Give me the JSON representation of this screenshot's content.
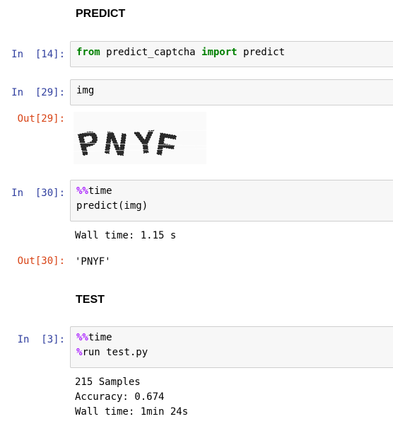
{
  "sections": {
    "predict_heading": "PREDICT",
    "test_heading": "TEST"
  },
  "cells": {
    "c14": {
      "prompt": "In  [14]:",
      "code": {
        "kw1": "from",
        "module": " predict_captcha ",
        "kw2": "import",
        "name": " predict"
      }
    },
    "c29": {
      "prompt": "In  [29]:",
      "code": "img",
      "out_prompt": "Out[29]:",
      "image_text": "PNYF"
    },
    "c30": {
      "prompt": "In  [30]:",
      "line1_magic": "%%",
      "line1_rest": "time",
      "line2": "predict(img)",
      "stdout": "Wall time: 1.15 s",
      "out_prompt": "Out[30]:",
      "result": "'PNYF'"
    },
    "c3": {
      "prompt": "In  [3]:",
      "line1_magic": "%%",
      "line1_rest": "time",
      "line2_magic": "%",
      "line2_rest": "run test.py",
      "stdout": [
        "215 Samples",
        "Accuracy: 0.674",
        "Wall time: 1min 24s"
      ]
    }
  }
}
